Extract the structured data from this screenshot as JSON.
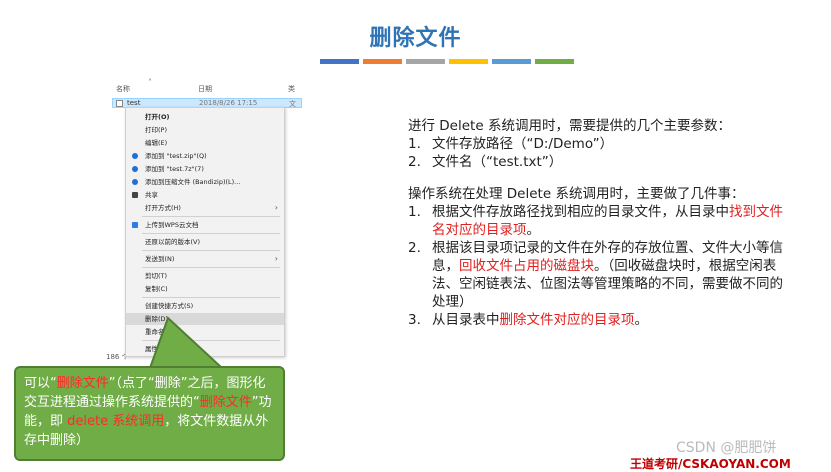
{
  "title": "删除文件",
  "color_bars": [
    "#4472c4",
    "#ed7d31",
    "#a5a5a5",
    "#ffc000",
    "#5b9bd5",
    "#70ad47"
  ],
  "explorer": {
    "col_name": "名称",
    "col_date": "日期",
    "col_type": "类",
    "file_name": "test",
    "file_date": "2018/8/26 17:15",
    "file_type": "文",
    "status_count": "186 个"
  },
  "context_menu": [
    {
      "label": "打开(O)",
      "bold": true
    },
    {
      "label": "打印(P)"
    },
    {
      "label": "编辑(E)"
    },
    {
      "label": "添加到 \"test.zip\"(Q)",
      "icon": "bandizip-icon"
    },
    {
      "label": "添加到 \"test.7z\"(7)",
      "icon": "bandizip-icon"
    },
    {
      "label": "添加到压缩文件 (Bandizip)(L)...",
      "icon": "bandizip-icon"
    },
    {
      "label": "共享",
      "icon": "share-icon"
    },
    {
      "label": "打开方式(H)",
      "submenu": true
    },
    {
      "label": "上传到WPS云文档",
      "icon": "wps-cloud-icon"
    },
    {
      "label": "还原以前的版本(V)"
    },
    {
      "label": "发送到(N)",
      "submenu": true
    },
    {
      "label": "剪切(T)"
    },
    {
      "label": "复制(C)"
    },
    {
      "label": "创建快捷方式(S)"
    },
    {
      "label": "删除(D)",
      "highlight": true
    },
    {
      "label": "重命名(M)"
    },
    {
      "label": "属性(R)"
    }
  ],
  "right": {
    "intro": "进行 Delete 系统调用时，需要提供的几个主要参数：",
    "params": [
      {
        "num": "1.",
        "text": "文件存放路径（“D:/Demo”）"
      },
      {
        "num": "2.",
        "text": "文件名（“test.txt”）"
      }
    ],
    "os_intro": "操作系统在处理 Delete 系统调用时，主要做了几件事：",
    "steps": {
      "s1_num": "1.",
      "s1_a": "根据文件存放路径找到相应的目录文件，从目录中",
      "s1_red": "找到文件名对应的目录项",
      "s1_b": "。",
      "s2_num": "2.",
      "s2_a": "根据该目录项记录的文件在外存的存放位置、文件大小等信息，",
      "s2_red": "回收文件占用的磁盘块",
      "s2_b": "。（回收磁盘块时，根据空闲表法、空闲链表法、位图法等管理策略的不同，需要做不同的处理）",
      "s3_num": "3.",
      "s3_a": "从目录表中",
      "s3_red": "删除文件对应的目录项",
      "s3_b": "。"
    }
  },
  "callout": {
    "p1": "可以“",
    "r1": "删除文件",
    "p2": "”（点了“删除”之后，图形化交互进程通过操作系统提供的“",
    "r2": "删除文件",
    "p3": "”功能，即 ",
    "r3": "delete 系统调用",
    "p4": "，将文件数据从外存中删除）"
  },
  "watermark": "CSDN @肥肥饼",
  "footer": "王道考研/CSKAOYAN.COM"
}
